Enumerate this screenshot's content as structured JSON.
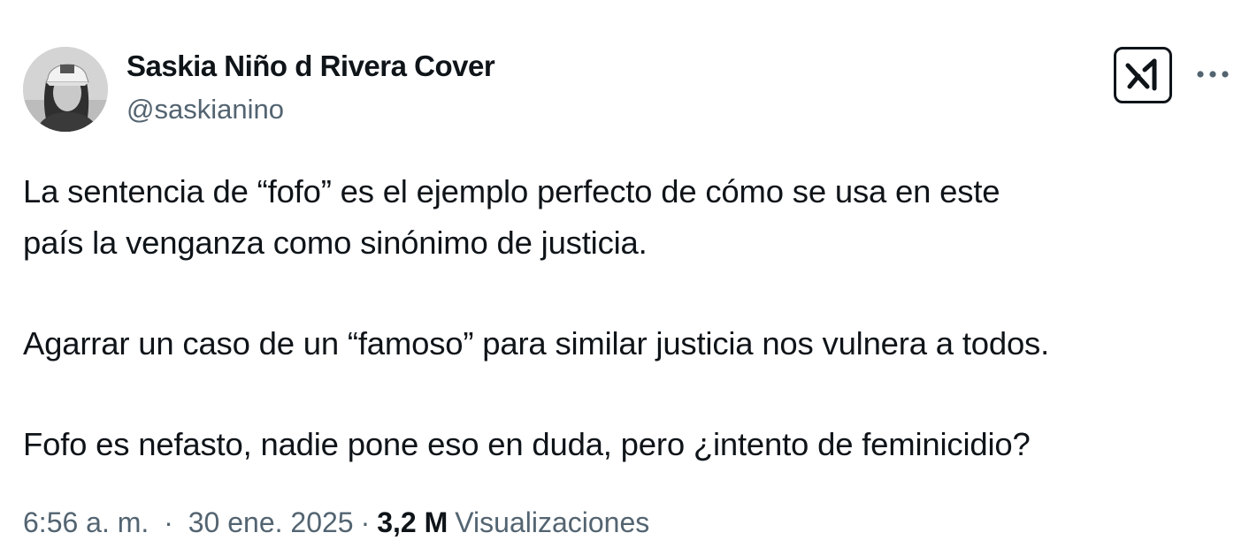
{
  "author": {
    "name": "Saskia Niño d Rivera Cover",
    "handle": "@saskianino"
  },
  "icons": {
    "avatar": "profile-photo",
    "grok": "grok-icon",
    "more": "more-horizontal-icon"
  },
  "post": {
    "paragraphs": [
      "La sentencia de “fofo” es el ejemplo perfecto de cómo se usa en este\npaís la venganza como sinónimo de justicia.",
      "Agarrar un caso de un “famoso” para similar justicia nos vulnera a todos.",
      "Fofo es nefasto, nadie pone eso en duda, pero ¿intento de feminicidio?"
    ]
  },
  "meta": {
    "time": "6:56 a. m.",
    "date": "30 ene. 2025",
    "separator": "·",
    "views_count": "3,2 M",
    "views_label": "Visualizaciones"
  },
  "colors": {
    "text_primary": "#0f1419",
    "text_secondary": "#536471",
    "background": "#ffffff"
  }
}
